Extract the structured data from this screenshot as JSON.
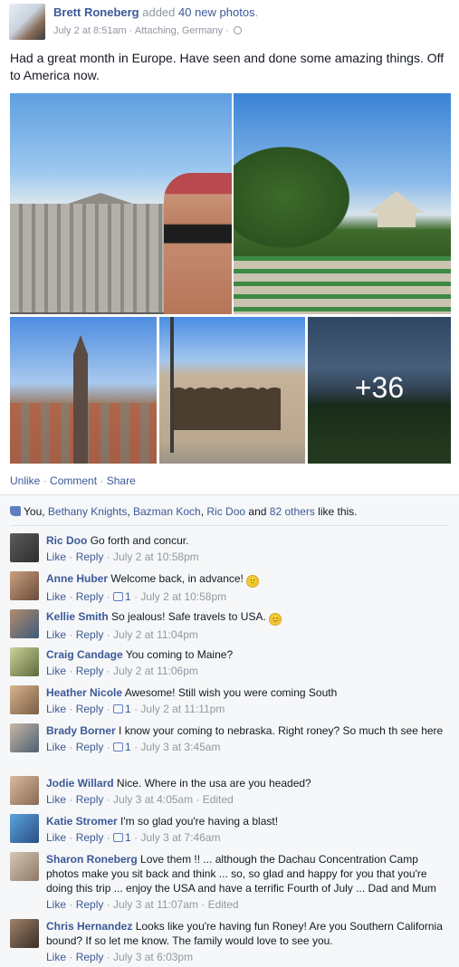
{
  "post": {
    "author": "Brett Roneberg",
    "action_prefix": " added ",
    "action_link": "40 new photos",
    "action_suffix": ".",
    "time": "July 2 at 8:51am",
    "sep": " · ",
    "attaching": "Attaching, Germany",
    "sep2": " · ",
    "privacy_icon": "globe-icon",
    "text": "Had a great month in Europe. Have seen and done some amazing things. Off to America now.",
    "more_photos": "+36"
  },
  "actions": {
    "unlike": "Unlike",
    "comment": "Comment",
    "share": "Share",
    "sep": " · "
  },
  "likes": {
    "you": "You, ",
    "names": [
      "Bethany Knights",
      "Bazman Koch",
      "Ric Doo"
    ],
    "comma": ", ",
    "and": " and ",
    "others": "82 others",
    "suffix": " like this."
  },
  "comment_labels": {
    "like": "Like",
    "reply": "Reply",
    "sep": " · ",
    "edited": "Edited"
  },
  "comments": [
    {
      "name": "Ric Doo",
      "text": "Go forth and concur.",
      "time": "July 2 at 10:58pm",
      "likes": "",
      "edited": false
    },
    {
      "name": "Anne Huber",
      "text": "Welcome back, in advance! ",
      "emoji": "🙂",
      "time": "July 2 at 10:58pm",
      "likes": "1",
      "edited": false
    },
    {
      "name": "Kellie Smith",
      "text": "So jealous! Safe travels to USA. ",
      "emoji": "😊",
      "time": "July 2 at 11:04pm",
      "likes": "",
      "edited": false
    },
    {
      "name": "Craig Candage",
      "text": "You coming to Maine?",
      "time": "July 2 at 11:06pm",
      "likes": "",
      "edited": false
    },
    {
      "name": "Heather Nicole",
      "text": "Awesome! Still wish you were coming South",
      "time": "July 2 at 11:11pm",
      "likes": "1",
      "edited": false
    },
    {
      "name": "Brady Borner",
      "text": "I know your coming to nebraska. Right roney? So much th see here",
      "time": "July 3 at 3:45am",
      "likes": "1",
      "edited": false
    },
    {
      "name": "Jodie Willard",
      "text": "Nice. Where in the usa are you headed?",
      "time": "July 3 at 4:05am",
      "likes": "",
      "edited": true
    },
    {
      "name": "Katie Stromer",
      "text": "I'm so glad you're having a blast!",
      "time": "July 3 at 7:46am",
      "likes": "1",
      "edited": false
    },
    {
      "name": "Sharon Roneberg",
      "text": "Love them !! ... although the Dachau Concentration Camp photos make you sit back and think ... so, so glad and happy for you that you're doing this trip ... enjoy the USA and have a terrific Fourth of July ... Dad and Mum",
      "time": "July 3 at 11:07am",
      "likes": "",
      "edited": true
    },
    {
      "name": "Chris Hernandez",
      "text": "Looks like you're having fun Roney! Are you Southern California bound? If so let me know. The family would love to see you.",
      "time": "July 3 at 6:03pm",
      "likes": "",
      "edited": false
    }
  ]
}
